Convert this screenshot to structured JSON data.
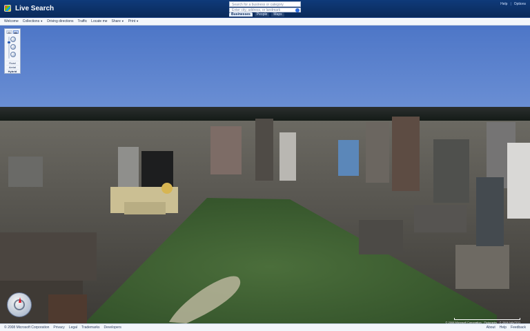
{
  "header": {
    "brand": "Live Search",
    "search_placeholder": "Search for a business or category",
    "address_placeholder": "Enter city, address, or landmark",
    "tabs": [
      {
        "label": "Businesses",
        "active": true
      },
      {
        "label": "People",
        "active": false
      },
      {
        "label": "Maps",
        "active": false
      }
    ],
    "links": [
      "Help",
      "Options"
    ]
  },
  "menubar": {
    "items": [
      {
        "label": "Welcome"
      },
      {
        "label": "Collections",
        "has_caret": true
      },
      {
        "label": "Driving directions"
      },
      {
        "label": "Traffic"
      },
      {
        "label": "Locate me"
      },
      {
        "label": "Share",
        "has_caret": true
      },
      {
        "label": "Print",
        "has_caret": true
      }
    ]
  },
  "controls": {
    "mode": [
      {
        "label": "2D",
        "active": false
      },
      {
        "label": "3D",
        "active": true
      }
    ],
    "map_styles": [
      {
        "label": "Road",
        "active": false
      },
      {
        "label": "Aerial",
        "active": false
      },
      {
        "label": "Hybrid",
        "active": true
      }
    ]
  },
  "map": {
    "attribution": "© 2008 Microsoft Corporation · Pictometry · © 2008 NAVTEQ",
    "scale_label": ""
  },
  "footer": {
    "left": [
      "© 2008 Microsoft Corporation",
      "Privacy",
      "Legal",
      "Trademarks",
      "Developers"
    ],
    "right": [
      "About",
      "Help",
      "Feedback"
    ]
  },
  "icons": {
    "compass": "compass-icon",
    "search": "search-icon",
    "nav": "navigation-icon"
  },
  "colors": {
    "header_bg": "#0a2a59",
    "sky": "#5b82c9",
    "park": "#3d5f2d"
  }
}
